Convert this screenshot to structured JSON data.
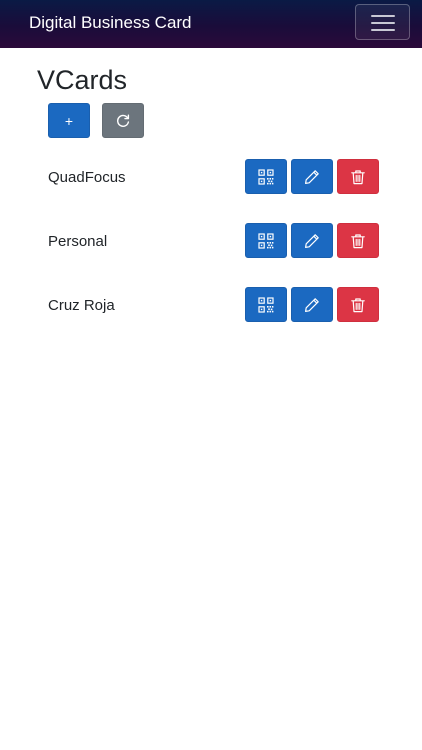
{
  "navbar": {
    "brand": "Digital Business Card",
    "toggler_icon": "hamburger-menu-icon",
    "colors": {
      "top": "#0a1a45",
      "bottom": "#2b0a3a"
    }
  },
  "page": {
    "title": "VCards"
  },
  "toolbar": {
    "add_label": "+",
    "refresh_icon": "refresh-icon"
  },
  "vcards": [
    {
      "name": "QuadFocus"
    },
    {
      "name": "Personal"
    },
    {
      "name": "Cruz Roja"
    }
  ],
  "row_actions": {
    "qr_icon": "qr-code-icon",
    "edit_icon": "pencil-icon",
    "delete_icon": "trash-icon"
  },
  "colors": {
    "primary": "#1b69c1",
    "secondary": "#6c757d",
    "danger": "#dc3545"
  }
}
